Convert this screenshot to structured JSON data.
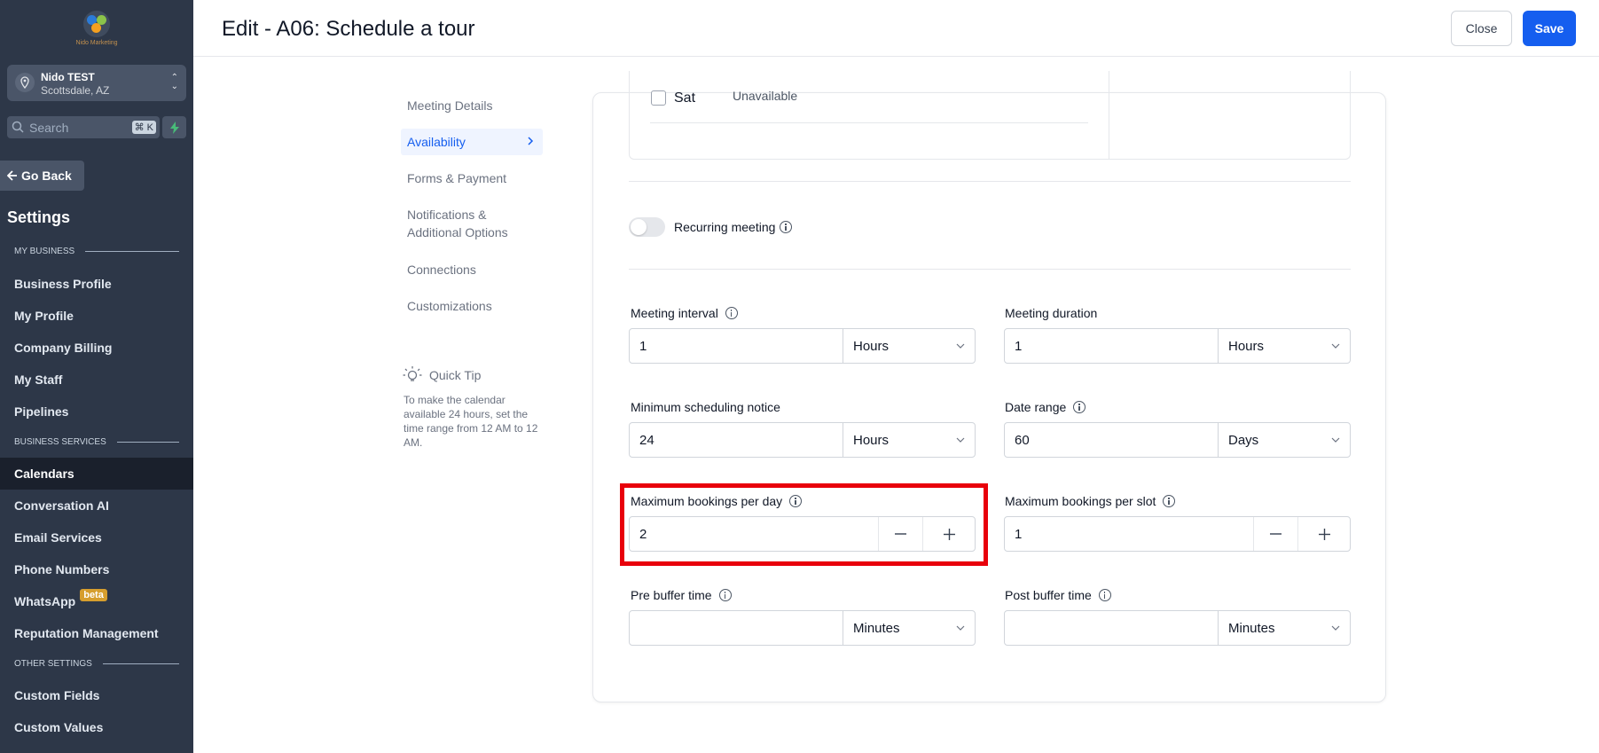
{
  "sidebar": {
    "logo_text": "Nido Marketing",
    "account": {
      "name": "Nido TEST",
      "location": "Scottsdale, AZ"
    },
    "search": {
      "placeholder": "Search",
      "shortcut": "⌘ K"
    },
    "go_back": "Go Back",
    "settings_title": "Settings",
    "sections": {
      "my_business": "MY BUSINESS",
      "business_services": "BUSINESS SERVICES",
      "other_settings": "OTHER SETTINGS"
    },
    "items": [
      {
        "label": "Business Profile"
      },
      {
        "label": "My Profile"
      },
      {
        "label": "Company Billing"
      },
      {
        "label": "My Staff"
      },
      {
        "label": "Pipelines"
      },
      {
        "label": "Calendars",
        "active": true
      },
      {
        "label": "Conversation AI"
      },
      {
        "label": "Email Services"
      },
      {
        "label": "Phone Numbers"
      },
      {
        "label": "WhatsApp",
        "badge": "beta"
      },
      {
        "label": "Reputation Management"
      },
      {
        "label": "Custom Fields"
      },
      {
        "label": "Custom Values"
      }
    ]
  },
  "header": {
    "title": "Edit - A06: Schedule a tour",
    "close_label": "Close",
    "save_label": "Save"
  },
  "subnav": {
    "items": [
      {
        "label": "Meeting Details"
      },
      {
        "label": "Availability",
        "active": true
      },
      {
        "label": "Forms & Payment"
      },
      {
        "label": "Notifications & Additional Options"
      },
      {
        "label": "Connections"
      },
      {
        "label": "Customizations"
      }
    ],
    "quick_tip": {
      "title": "Quick Tip",
      "text": "To make the calendar available 24 hours, set the time range from 12 AM to 12 AM."
    }
  },
  "availability": {
    "day": "Sat",
    "status": "Unavailable"
  },
  "recurring": {
    "label": "Recurring meeting",
    "enabled": false
  },
  "fields": {
    "meeting_interval": {
      "label": "Meeting interval",
      "value": "1",
      "unit": "Hours"
    },
    "meeting_duration": {
      "label": "Meeting duration",
      "value": "1",
      "unit": "Hours"
    },
    "min_notice": {
      "label": "Minimum scheduling notice",
      "value": "24",
      "unit": "Hours"
    },
    "date_range": {
      "label": "Date range",
      "value": "60",
      "unit": "Days"
    },
    "max_per_day": {
      "label": "Maximum bookings per day",
      "value": "2"
    },
    "max_per_slot": {
      "label": "Maximum bookings per slot",
      "value": "1"
    },
    "pre_buffer": {
      "label": "Pre buffer time",
      "value": "",
      "unit": "Minutes"
    },
    "post_buffer": {
      "label": "Post buffer time",
      "value": "",
      "unit": "Minutes"
    }
  },
  "colors": {
    "sidebar_bg": "#2d3748",
    "accent": "#155eef",
    "highlight": "#e8000b"
  }
}
